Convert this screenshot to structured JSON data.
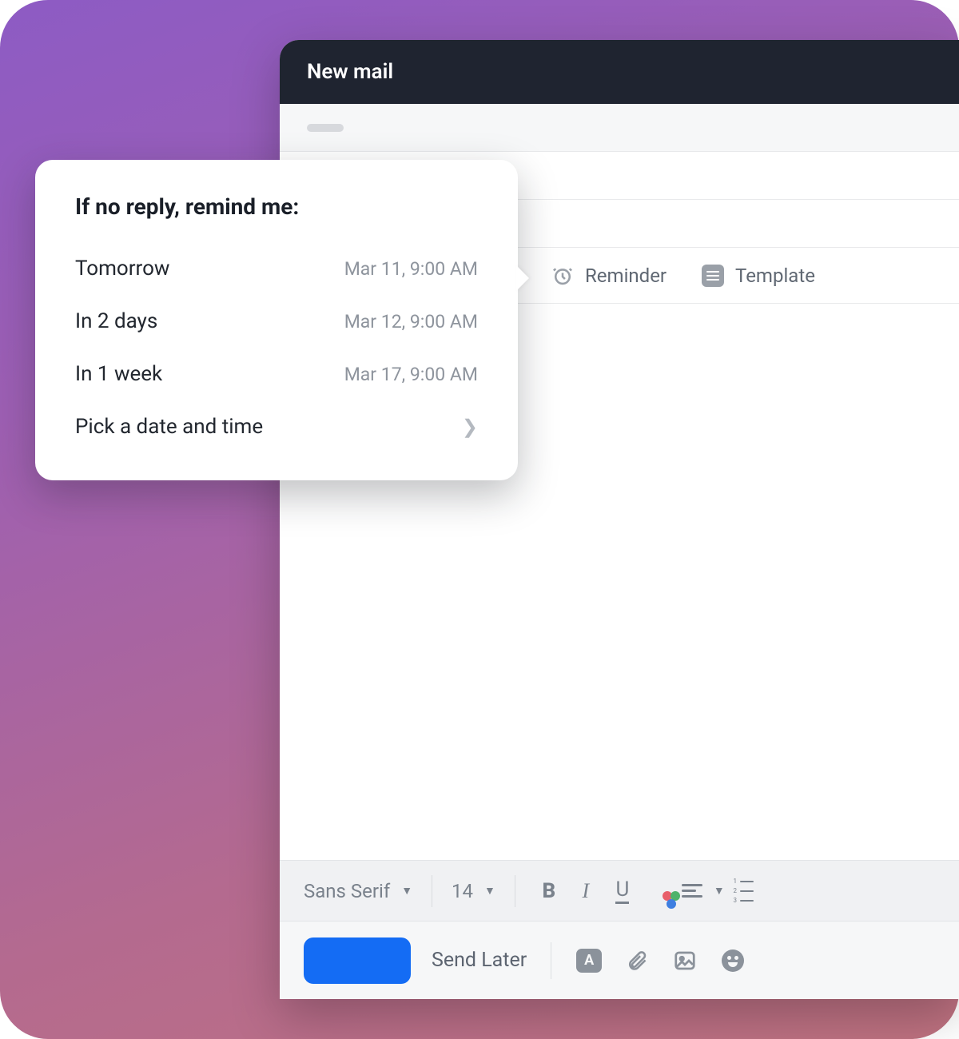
{
  "window": {
    "title": "New mail"
  },
  "toolbar": {
    "reminder_label": "Reminder",
    "template_label": "Template"
  },
  "format_bar": {
    "font_family": "Sans Serif",
    "font_size": "14"
  },
  "action_bar": {
    "send_later_label": "Send Later"
  },
  "reminder_popover": {
    "title": "If no reply, remind me:",
    "options": [
      {
        "label": "Tomorrow",
        "value": "Mar 11, 9:00 AM"
      },
      {
        "label": "In 2 days",
        "value": "Mar 12, 9:00 AM"
      },
      {
        "label": "In 1 week",
        "value": "Mar 17, 9:00 AM"
      }
    ],
    "pick_label": "Pick a date and time"
  }
}
